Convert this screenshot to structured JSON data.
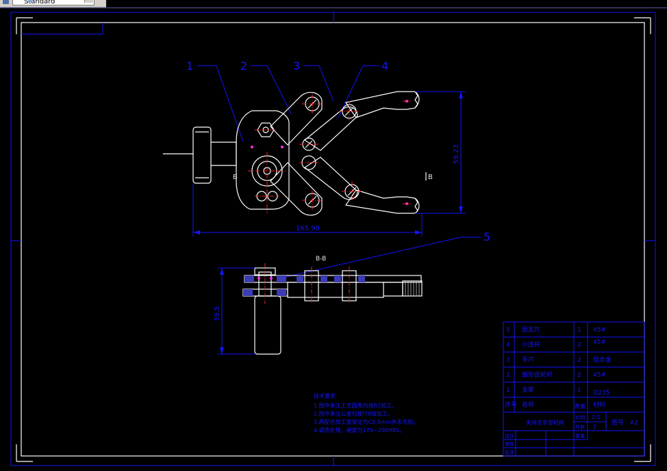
{
  "toolbar": {
    "style_value": "Standard"
  },
  "callouts": [
    "1",
    "2",
    "3",
    "4",
    "5"
  ],
  "dimensions": {
    "width": "165.99",
    "height": "59.23",
    "side": "39.5"
  },
  "section_marks": {
    "left": "B",
    "right": "B",
    "view_label": "B-B"
  },
  "notes": {
    "title": "技术要求",
    "items": [
      "1.图中未注工艺圆角均按R2加工。",
      "2.图中未注公差均按IT8级加工。",
      "3.两配合加工面保证为C0.5mm并去毛刺。",
      "4.调质处理，硬度为170~200HBS。"
    ]
  },
  "parts": [
    {
      "no": "5",
      "name": "固定片",
      "qty": "1",
      "material": "45#"
    },
    {
      "no": "4",
      "name": "小连杆",
      "qty": "2",
      "material": "45#"
    },
    {
      "no": "3",
      "name": "手爪",
      "qty": "2",
      "material": "铝合金"
    },
    {
      "no": "2",
      "name": "扇形齿轮杆",
      "qty": "2",
      "material": "45#"
    },
    {
      "no": "1",
      "name": "支架",
      "qty": "1",
      "material": "Q235"
    }
  ],
  "table_header": {
    "no": "序号",
    "name": "名称",
    "qty": "数量",
    "material": "材料"
  },
  "title_block": {
    "drawing_name": "夹持式手部机构",
    "scale_label": "比例",
    "scale_value": "2:1",
    "weight_label": "件数",
    "weight_value": "1",
    "sheet_label": "图号",
    "sheet_value": "A2",
    "sheet_full": "图号：A2",
    "mat_label": "重量",
    "designer": "设计",
    "checker": "审核",
    "approver": "批准"
  }
}
